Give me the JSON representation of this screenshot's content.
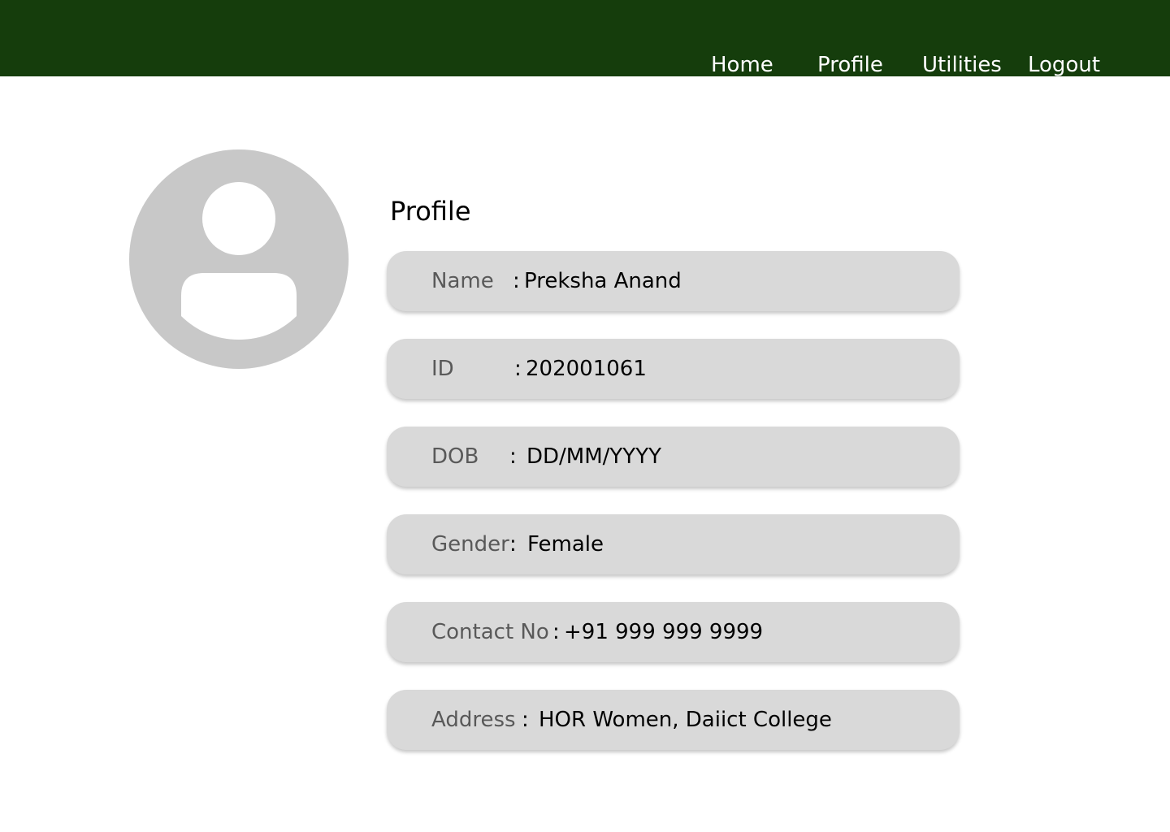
{
  "nav": {
    "home": "Home",
    "profile": "Profile",
    "utilities": "Utilities",
    "logout": "Logout"
  },
  "page": {
    "title": "Profile"
  },
  "avatar": {
    "icon": "user-avatar-icon"
  },
  "fields": [
    {
      "label": "Name",
      "separator": ":",
      "value": "Preksha  Anand"
    },
    {
      "label": "ID",
      "separator": ":",
      "value": "202001061"
    },
    {
      "label": "DOB",
      "separator": ":",
      "value": "DD/MM/YYYY"
    },
    {
      "label": "Gender",
      "separator": ":",
      "value": "Female"
    },
    {
      "label": "Contact No",
      "separator": ":",
      "value": "+91 999 999 9999"
    },
    {
      "label": "Address",
      "separator": ":",
      "value": "HOR Women, Daiict College"
    }
  ],
  "colors": {
    "header": "#153d0c",
    "field_background": "#d9d9d9",
    "label_text": "#595959",
    "avatar": "#c8c8c8"
  }
}
